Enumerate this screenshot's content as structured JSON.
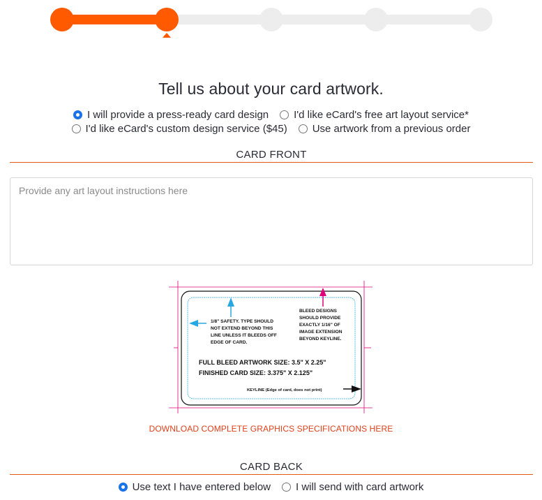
{
  "progress": {
    "total_steps": 5,
    "current_step": 2
  },
  "heading": "Tell us about your card artwork.",
  "artwork_options": {
    "selected": "press_ready",
    "row1": [
      {
        "id": "press_ready",
        "label": "I will provide a press-ready card design",
        "checked": true
      },
      {
        "id": "free_layout",
        "label": "I'd like eCard's free art layout service*",
        "checked": false
      }
    ],
    "row2": [
      {
        "id": "custom_design",
        "label": "I'd like eCard's custom design service ($45)",
        "checked": false
      },
      {
        "id": "previous_order",
        "label": "Use artwork from a previous order",
        "checked": false
      }
    ]
  },
  "card_front": {
    "title": "CARD FRONT",
    "instructions_placeholder": "Provide any art layout instructions here",
    "instructions_value": ""
  },
  "spec_diagram": {
    "safety_note_lines": [
      "1/8\" SAFETY.  TYPE SHOULD",
      "NOT EXTEND BEYOND THIS",
      "LINE UNLESS IT BLEEDS OFF",
      "EDGE OF CARD."
    ],
    "bleed_note_lines": [
      "BLEED DESIGNS",
      "SHOULD PROVIDE",
      "EXACTLY 1/16\" OF",
      "IMAGE EXTENSION",
      "BEYOND KEYLINE."
    ],
    "full_bleed": "FULL BLEED ARTWORK SIZE:  3.5\" X 2.25\"",
    "finished_size": "FINISHED CARD SIZE:  3.375\" X 2.125\"",
    "keyline": "KEYLINE (Edge of card, does not print)",
    "colors": {
      "bleed": "#e0007a",
      "safety": "#29a8e0",
      "keyline": "#111111"
    }
  },
  "download_link": "DOWNLOAD COMPLETE GRAPHICS SPECIFICATIONS HERE",
  "card_back": {
    "title": "CARD BACK",
    "options": [
      {
        "id": "use_text",
        "label": "Use text I have entered below",
        "checked": true
      },
      {
        "id": "send_artwork",
        "label": "I will send with card artwork",
        "checked": false
      }
    ]
  },
  "colors": {
    "accent": "#ff5a00",
    "track": "#ededee",
    "rule": "#e05a12",
    "link": "#e0401a",
    "radio_checked": "#1a73e8"
  }
}
